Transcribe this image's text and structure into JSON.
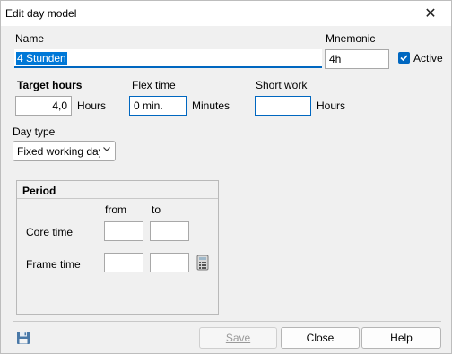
{
  "window": {
    "title": "Edit day model",
    "close_glyph": "✕"
  },
  "name": {
    "label": "Name",
    "value": "4 Stunden"
  },
  "mnemonic": {
    "label": "Mnemonic",
    "value": "4h"
  },
  "active": {
    "label": "Active",
    "checked": true
  },
  "target_hours": {
    "label": "Target hours",
    "value": "4,0",
    "unit": "Hours"
  },
  "flex_time": {
    "label": "Flex time",
    "value": "0 min.",
    "unit": "Minutes"
  },
  "short_work": {
    "label": "Short work",
    "value": "",
    "unit": "Hours"
  },
  "day_type": {
    "label": "Day type",
    "value": "Fixed working day"
  },
  "period": {
    "title": "Period",
    "col_from": "from",
    "col_to": "to",
    "core_time": {
      "label": "Core time",
      "from": "",
      "to": ""
    },
    "frame_time": {
      "label": "Frame time",
      "from": "",
      "to": ""
    }
  },
  "buttons": {
    "save": "Save",
    "close": "Close",
    "help": "Help"
  },
  "icons": {
    "disk": "floppy-disk-icon",
    "calc": "calculator-icon",
    "check": "checkbox-check-icon"
  },
  "colors": {
    "accent": "#0067c0",
    "selection": "#0078d7"
  }
}
